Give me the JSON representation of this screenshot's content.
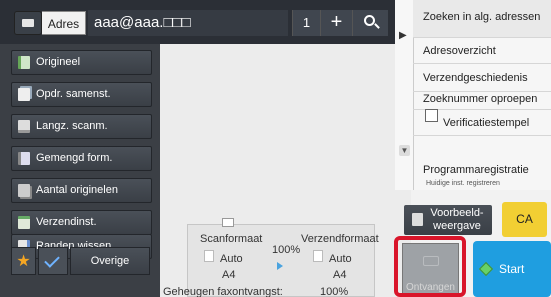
{
  "topbar": {
    "address_label": "Adres",
    "address_value": "aaa@aaa.□□□",
    "count": "1",
    "plus": "+"
  },
  "left": {
    "items": [
      {
        "label": "Origineel"
      },
      {
        "label": "Opdr. samenst."
      },
      {
        "label": "Langz. scanm."
      },
      {
        "label": "Gemengd form."
      },
      {
        "label": "Aantal originelen"
      },
      {
        "label": "Verzendinst."
      },
      {
        "label": "Randen wissen"
      }
    ],
    "star": "★",
    "other_label": "Overige"
  },
  "summary": {
    "scan_format_label": "Scanformaat",
    "send_format_label": "Verzendformaat",
    "zoom": "100%",
    "scan_auto": "Auto",
    "send_auto": "Auto",
    "scan_size": "A4",
    "send_size": "A4",
    "fax_memory_label": "Geheugen faxontvangst:",
    "fax_memory_value": "100%"
  },
  "right": {
    "items": [
      {
        "label": "Zoeken in alg. adressen"
      },
      {
        "label": "Adresoverzicht"
      },
      {
        "label": "Verzendgeschiedenis"
      },
      {
        "label": "Zoeknummer oproepen"
      },
      {
        "label": "Verificatiestempel"
      },
      {
        "label": "Programmaregistratie"
      }
    ],
    "program_sub": "Huidige inst. registreren",
    "chevron_top": "▶",
    "chevron_bottom": "▼"
  },
  "actions": {
    "preview_label": "Voorbeeld-weergave",
    "ca_label": "CA",
    "receive_label": "Ontvangen",
    "start_label": "Start"
  },
  "colors": {
    "accent": "#1f9ee0",
    "ca": "#f2cf33",
    "highlight": "#d9152a"
  }
}
